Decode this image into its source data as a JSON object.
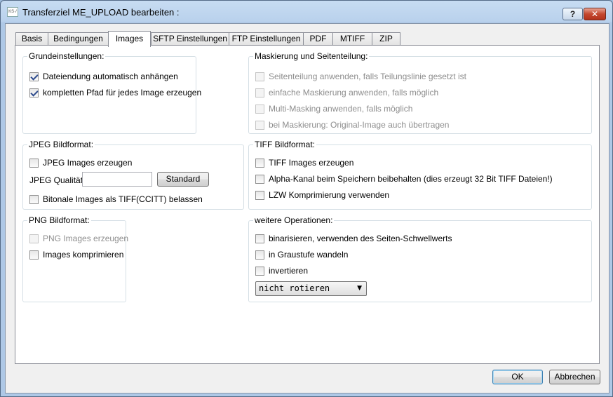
{
  "window": {
    "title": "Transferziel ME_UPLOAD bearbeiten :",
    "icon_text": "KS·/",
    "help_label": "?",
    "close_label": "✕"
  },
  "tabs": [
    {
      "label": "Basis"
    },
    {
      "label": "Bedingungen"
    },
    {
      "label": "Images",
      "active": true
    },
    {
      "label": "SFTP Einstellungen"
    },
    {
      "label": "FTP Einstellungen"
    },
    {
      "label": "PDF"
    },
    {
      "label": "MTIFF"
    },
    {
      "label": "ZIP"
    }
  ],
  "grundeinstellungen": {
    "title": "Grundeinstellungen:",
    "items": [
      {
        "label": "Dateiendung automatisch anhängen",
        "checked": true
      },
      {
        "label": "kompletten Pfad für jedes Image erzeugen",
        "checked": true
      }
    ]
  },
  "maskierung": {
    "title": "Maskierung und Seitenteilung:",
    "items": [
      {
        "label": "Seitenteilung anwenden, falls Teilungslinie gesetzt ist",
        "checked": false,
        "disabled": true
      },
      {
        "label": "einfache Maskierung anwenden, falls möglich",
        "checked": false,
        "disabled": true
      },
      {
        "label": "Multi-Masking anwenden, falls möglich",
        "checked": false,
        "disabled": true
      },
      {
        "label": "bei Maskierung: Original-Image auch übertragen",
        "checked": false,
        "disabled": true
      }
    ]
  },
  "jpeg": {
    "title": "JPEG Bildformat:",
    "create_label": "JPEG Images erzeugen",
    "quality_label": "JPEG Qualität:",
    "quality_value": "",
    "standard_button": "Standard",
    "bitonal_label": "Bitonale Images als TIFF(CCITT) belassen"
  },
  "tiff": {
    "title": "TIFF Bildformat:",
    "items": [
      {
        "label": "TIFF Images erzeugen",
        "checked": false
      },
      {
        "label": "Alpha-Kanal beim Speichern beibehalten (dies erzeugt 32 Bit TIFF Dateien!)",
        "checked": false
      },
      {
        "label": "LZW Komprimierung verwenden",
        "checked": false
      }
    ]
  },
  "png": {
    "title": "PNG Bildformat:",
    "items": [
      {
        "label": "PNG Images erzeugen",
        "checked": false,
        "disabled": true
      },
      {
        "label": "Images komprimieren",
        "checked": false
      }
    ]
  },
  "weitere": {
    "title": "weitere Operationen:",
    "items": [
      {
        "label": "binarisieren, verwenden des Seiten-Schwellwerts",
        "checked": false
      },
      {
        "label": "in Graustufe wandeln",
        "checked": false
      },
      {
        "label": "invertieren",
        "checked": false
      }
    ],
    "rotate_selected": "nicht rotieren"
  },
  "footer": {
    "ok_label": "OK",
    "cancel_label": "Abbrechen"
  }
}
